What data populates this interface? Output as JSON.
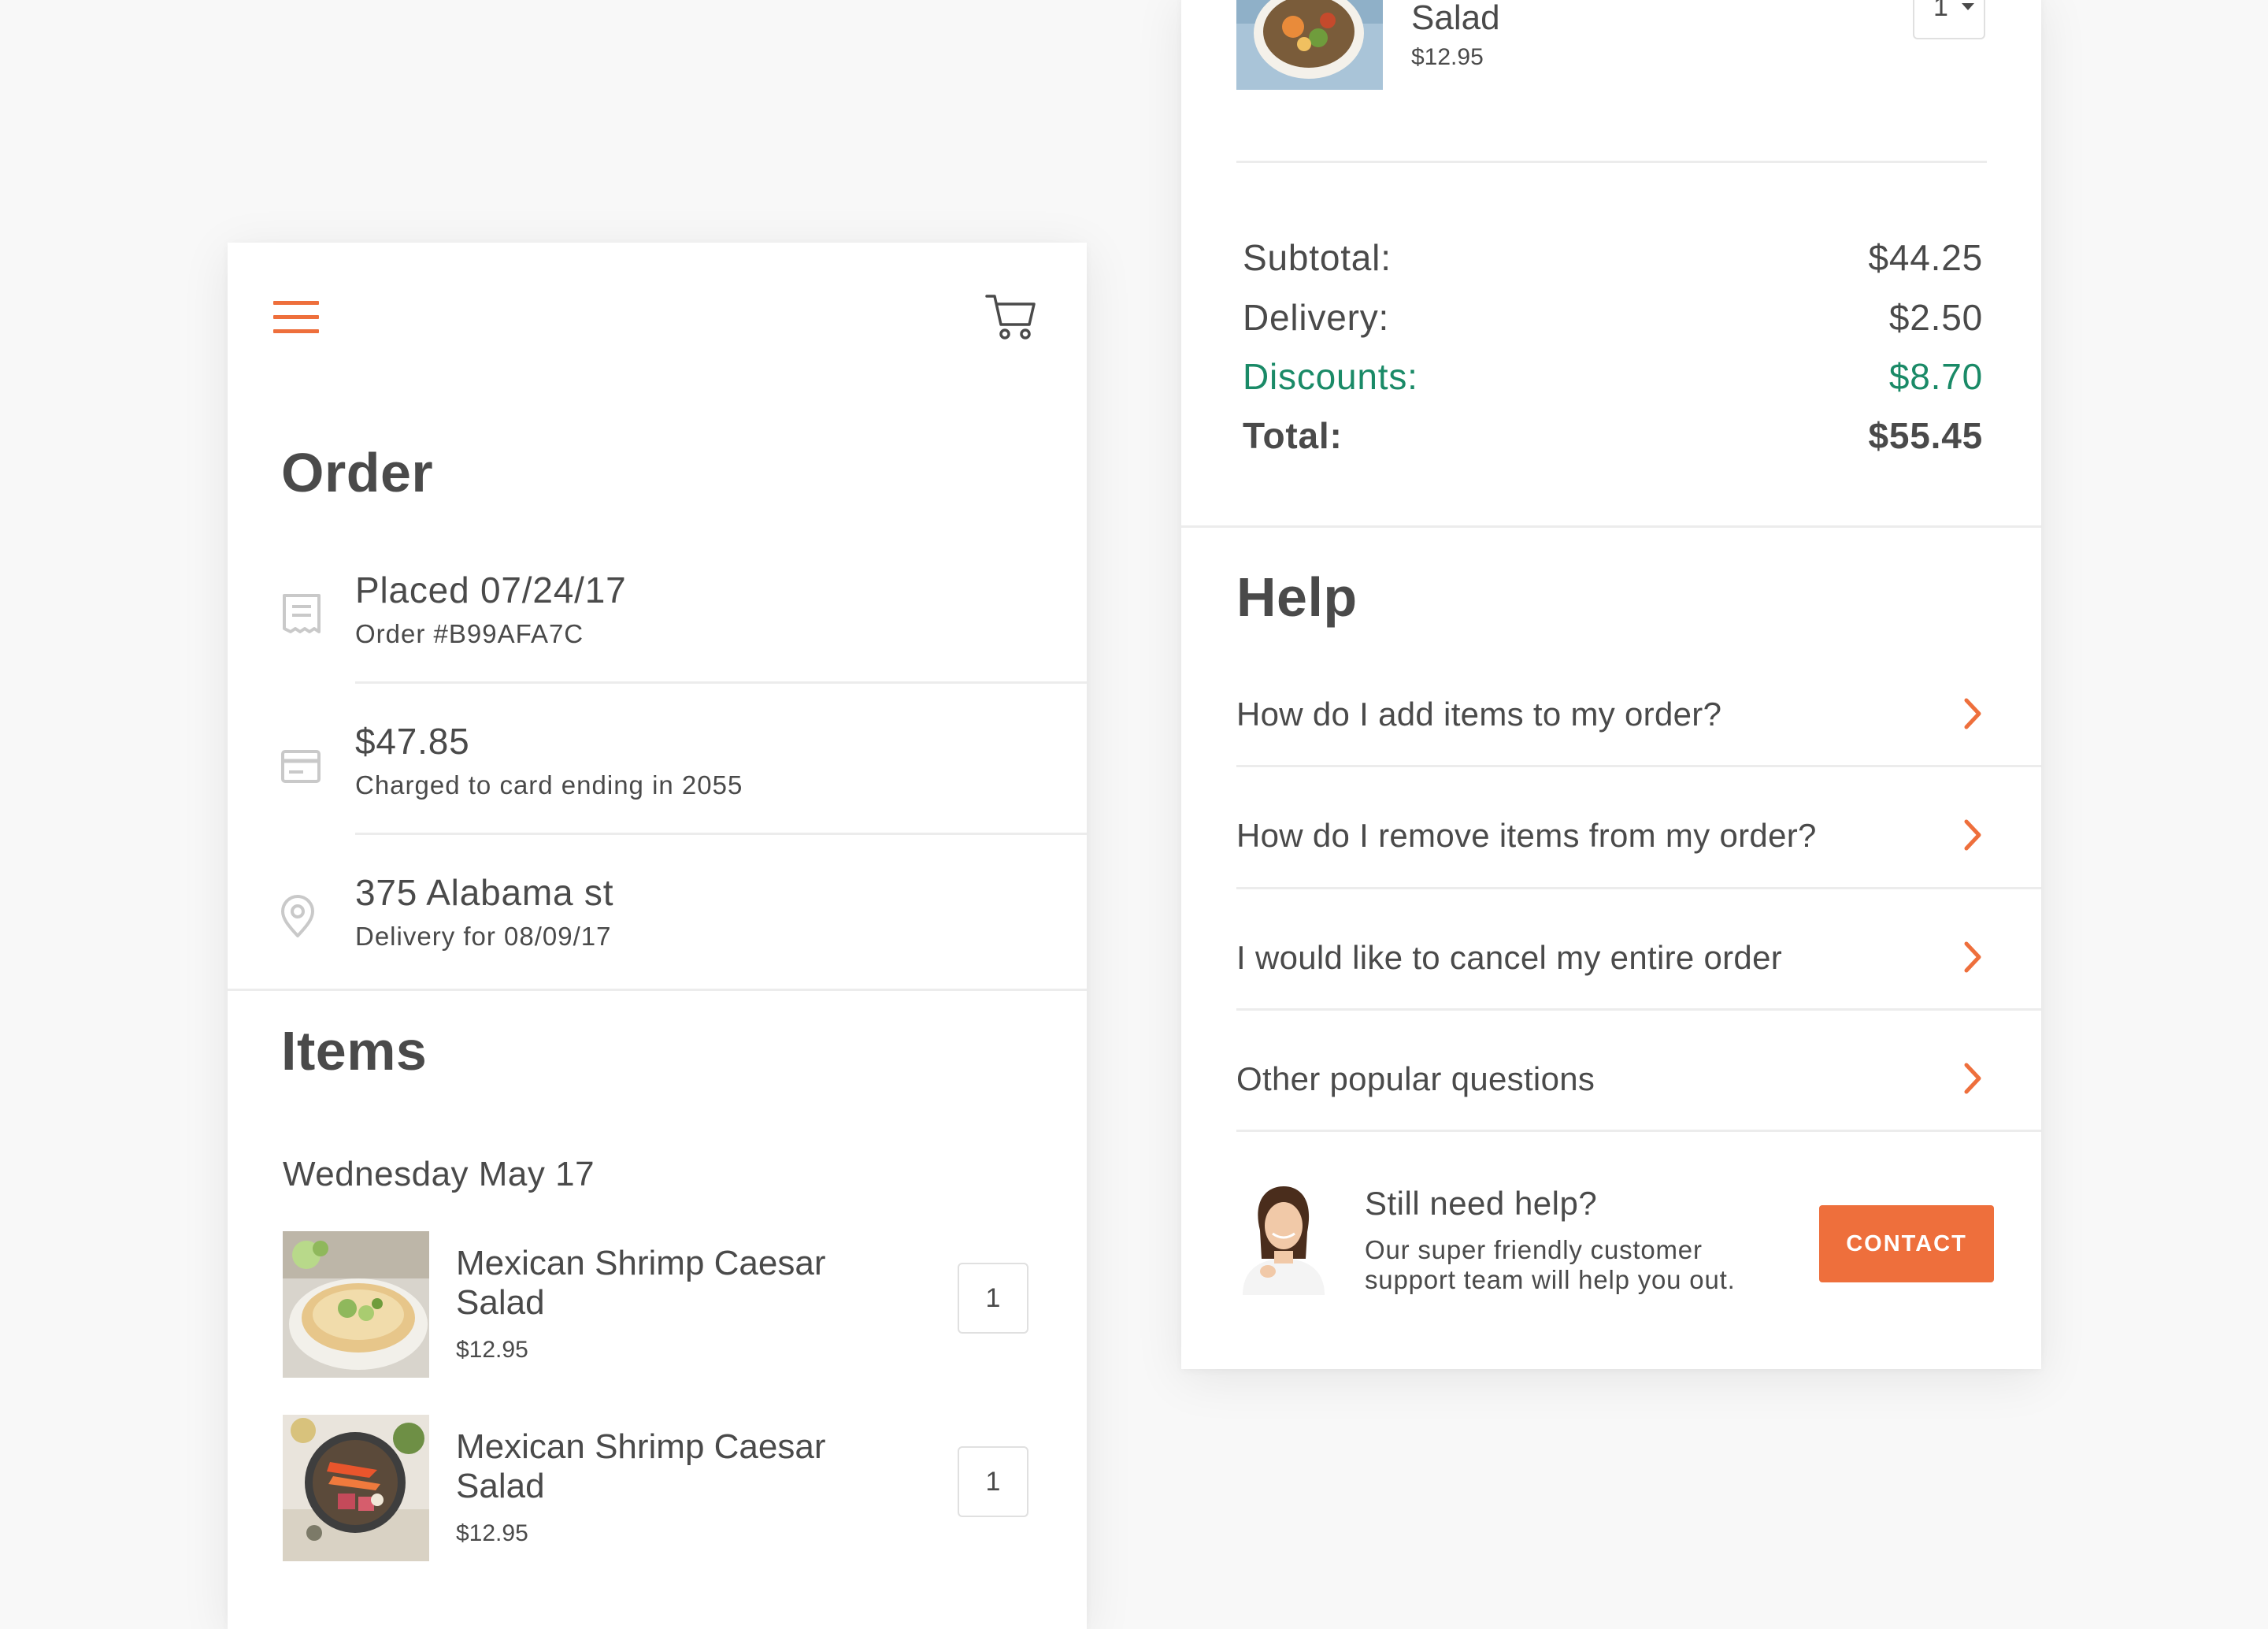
{
  "colors": {
    "accent": "#ee6f3c",
    "discount": "#1a8a67",
    "text": "#4a4a4a",
    "background": "#f8f8f8"
  },
  "left_card": {
    "menu_icon": "hamburger-menu-icon",
    "cart_icon": "shopping-cart-icon",
    "order_section": {
      "title": "Order",
      "rows": [
        {
          "icon": "receipt-icon",
          "primary": "Placed 07/24/17",
          "secondary": "Order #B99AFA7C"
        },
        {
          "icon": "credit-card-icon",
          "primary": "$47.85",
          "secondary": "Charged to card ending in 2055"
        },
        {
          "icon": "location-pin-icon",
          "primary": "375 Alabama st",
          "secondary": "Delivery for 08/09/17"
        }
      ]
    },
    "items_section": {
      "title": "Items",
      "date": "Wednesday May 17",
      "items": [
        {
          "name": "Mexican Shrimp Caesar Salad",
          "price": "$12.95",
          "quantity": "1"
        },
        {
          "name": "Mexican Shrimp Caesar Salad",
          "price": "$12.95",
          "quantity": "1"
        }
      ]
    }
  },
  "right_card": {
    "top_item": {
      "name": "Salad",
      "price": "$12.95",
      "quantity": "1"
    },
    "summary": {
      "subtotal_label": "Subtotal:",
      "subtotal_value": "$44.25",
      "delivery_label": "Delivery:",
      "delivery_value": "$2.50",
      "discounts_label": "Discounts:",
      "discounts_value": "$8.70",
      "total_label": "Total:",
      "total_value": "$55.45"
    },
    "help": {
      "title": "Help",
      "questions": [
        "How do I add items to my order?",
        "How do I remove items from my order?",
        "I would like to cancel my entire order",
        "Other popular questions"
      ],
      "cta_title": "Still need help?",
      "cta_description": "Our super friendly customer support team will help you out.",
      "contact_label": "CONTACT"
    }
  }
}
